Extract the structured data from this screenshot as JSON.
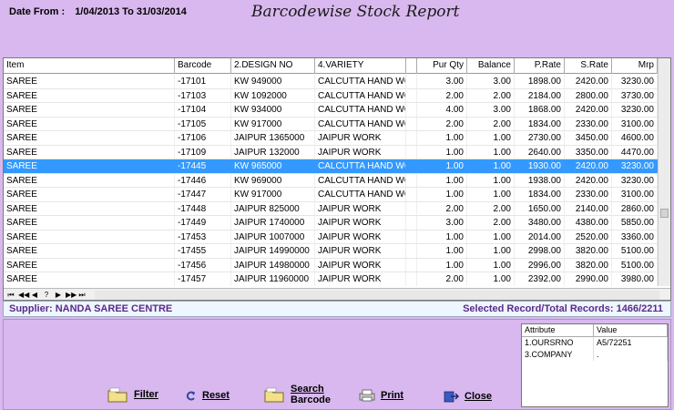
{
  "header": {
    "date_label": "Date From :",
    "date_range": "1/04/2013 To 31/03/2014",
    "title": "Barcodewise Stock Report"
  },
  "grid": {
    "columns": [
      "Item",
      "Barcode",
      "2.DESIGN NO",
      "4.VARIETY",
      "",
      "Pur Qty",
      "Balance",
      "P.Rate",
      "S.Rate",
      "Mrp"
    ],
    "rows": [
      [
        "SAREE",
        "-17101",
        "KW 949000",
        "CALCUTTA HAND WORK",
        "",
        "3.00",
        "3.00",
        "1898.00",
        "2420.00",
        "3230.00"
      ],
      [
        "SAREE",
        "-17103",
        "KW 1092000",
        "CALCUTTA HAND WORK",
        "",
        "2.00",
        "2.00",
        "2184.00",
        "2800.00",
        "3730.00"
      ],
      [
        "SAREE",
        "-17104",
        "KW 934000",
        "CALCUTTA HAND WORK",
        "",
        "4.00",
        "3.00",
        "1868.00",
        "2420.00",
        "3230.00"
      ],
      [
        "SAREE",
        "-17105",
        "KW 917000",
        "CALCUTTA HAND WORK",
        "",
        "2.00",
        "2.00",
        "1834.00",
        "2330.00",
        "3100.00"
      ],
      [
        "SAREE",
        "-17106",
        "JAIPUR 1365000",
        "JAIPUR WORK",
        "",
        "1.00",
        "1.00",
        "2730.00",
        "3450.00",
        "4600.00"
      ],
      [
        "SAREE",
        "-17109",
        "JAIPUR 132000",
        "JAIPUR WORK",
        "",
        "1.00",
        "1.00",
        "2640.00",
        "3350.00",
        "4470.00"
      ],
      [
        "SAREE",
        "-17445",
        "KW 965000",
        "CALCUTTA HAND WORK",
        "",
        "1.00",
        "1.00",
        "1930.00",
        "2420.00",
        "3230.00"
      ],
      [
        "SAREE",
        "-17446",
        "KW 969000",
        "CALCUTTA HAND WORK",
        "",
        "1.00",
        "1.00",
        "1938.00",
        "2420.00",
        "3230.00"
      ],
      [
        "SAREE",
        "-17447",
        "KW 917000",
        "CALCUTTA HAND WORK",
        "",
        "1.00",
        "1.00",
        "1834.00",
        "2330.00",
        "3100.00"
      ],
      [
        "SAREE",
        "-17448",
        "JAIPUR 825000",
        "JAIPUR WORK",
        "",
        "2.00",
        "2.00",
        "1650.00",
        "2140.00",
        "2860.00"
      ],
      [
        "SAREE",
        "-17449",
        "JAIPUR 1740000",
        "JAIPUR WORK",
        "",
        "3.00",
        "2.00",
        "3480.00",
        "4380.00",
        "5850.00"
      ],
      [
        "SAREE",
        "-17453",
        "JAIPUR 1007000",
        "JAIPUR WORK",
        "",
        "1.00",
        "1.00",
        "2014.00",
        "2520.00",
        "3360.00"
      ],
      [
        "SAREE",
        "-17455",
        "JAIPUR 14990000",
        "JAIPUR WORK",
        "",
        "1.00",
        "1.00",
        "2998.00",
        "3820.00",
        "5100.00"
      ],
      [
        "SAREE",
        "-17456",
        "JAIPUR 14980000",
        "JAIPUR WORK",
        "",
        "1.00",
        "1.00",
        "2996.00",
        "3820.00",
        "5100.00"
      ],
      [
        "SAREE",
        "-17457",
        "JAIPUR 11960000",
        "JAIPUR WORK",
        "",
        "2.00",
        "1.00",
        "2392.00",
        "2990.00",
        "3980.00"
      ]
    ],
    "selected_row": 6,
    "nav": [
      "⏮",
      "◀◀",
      "◀",
      "?",
      "▶",
      "▶▶",
      "⏭"
    ]
  },
  "status": {
    "supplier": "Supplier: NANDA SAREE CENTRE",
    "records": "Selected Record/Total Records: 1466/2211"
  },
  "actions": {
    "filter": "Filter",
    "reset": "Reset",
    "search_line1": "Search",
    "search_line2": "Barcode",
    "print": "Print",
    "close": "Close"
  },
  "attributes": {
    "headers": [
      "Attribute",
      "Value"
    ],
    "rows": [
      [
        "1.OURSRNO",
        "A5/72251"
      ],
      [
        "3.COMPANY",
        "."
      ]
    ]
  },
  "colors": {
    "background": "#d8b8ee",
    "selection": "#3399ff",
    "status_text": "#5a2a8a"
  }
}
